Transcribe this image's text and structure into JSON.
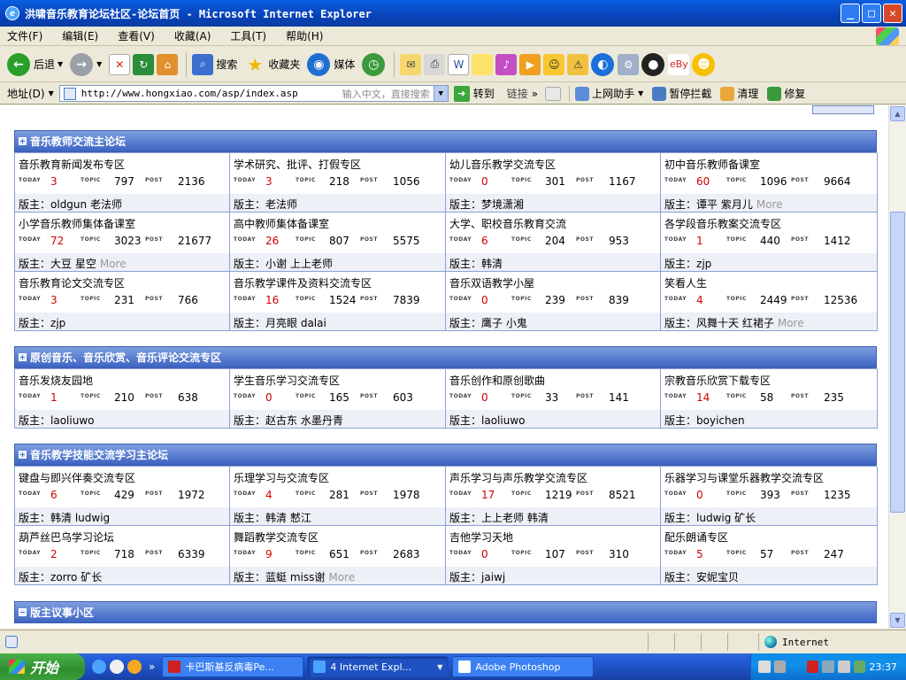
{
  "window": {
    "title": "洪啸音乐教育论坛社区-论坛首页 - Microsoft Internet Explorer"
  },
  "menu": [
    "文件(F)",
    "编辑(E)",
    "查看(V)",
    "收藏(A)",
    "工具(T)",
    "帮助(H)"
  ],
  "toolbar": {
    "back": "后退",
    "search": "搜索",
    "favorites": "收藏夹",
    "media": "媒体"
  },
  "address": {
    "label": "地址(D)",
    "url": "http://www.hongxiao.com/asp/index.asp",
    "hint": "输入中文，直接搜索",
    "go": "转到",
    "links": "链接",
    "helper": "上网助手",
    "popup": "暂停拦截",
    "clean": "清理",
    "fix": "修复"
  },
  "labels": {
    "today": "TODAY",
    "topic": "TOPIC",
    "post": "POST",
    "moderator": "版主：",
    "more": "More"
  },
  "sections": [
    {
      "title": "音乐教师交流主论坛",
      "toggle": "+",
      "forums": [
        {
          "name": "音乐教育新闻发布专区",
          "today": "3",
          "topic": "797",
          "post": "2136",
          "mods": "oldgun  老法师",
          "more": ""
        },
        {
          "name": "学术研究、批评、打假专区",
          "today": "3",
          "topic": "218",
          "post": "1056",
          "mods": "老法师",
          "more": ""
        },
        {
          "name": "幼儿音乐教学交流专区",
          "today": "0",
          "topic": "301",
          "post": "1167",
          "mods": "梦境潇湘",
          "more": ""
        },
        {
          "name": "初中音乐教师备课室",
          "today": "60",
          "topic": "1096",
          "post": "9664",
          "mods": "谭平  紫月儿",
          "more": "More"
        },
        {
          "name": "小学音乐教师集体备课室",
          "today": "72",
          "topic": "3023",
          "post": "21677",
          "mods": "大豆  星空",
          "more": "More"
        },
        {
          "name": "高中教师集体备课室",
          "today": "26",
          "topic": "807",
          "post": "5575",
          "mods": "小谢  上上老师",
          "more": ""
        },
        {
          "name": "大学、职校音乐教育交流",
          "today": "6",
          "topic": "204",
          "post": "953",
          "mods": "韩清",
          "more": ""
        },
        {
          "name": "各学段音乐教案交流专区",
          "today": "1",
          "topic": "440",
          "post": "1412",
          "mods": "zjp",
          "more": ""
        },
        {
          "name": "音乐教育论文交流专区",
          "today": "3",
          "topic": "231",
          "post": "766",
          "mods": "zjp",
          "more": ""
        },
        {
          "name": "音乐教学课件及资料交流专区",
          "today": "16",
          "topic": "1524",
          "post": "7839",
          "mods": "月亮眼  dalai",
          "more": ""
        },
        {
          "name": "音乐双语教学小屋",
          "today": "0",
          "topic": "239",
          "post": "839",
          "mods": "鹰子  小鬼",
          "more": ""
        },
        {
          "name": "笑看人生",
          "today": "4",
          "topic": "2449",
          "post": "12536",
          "mods": "风舞十天  红裙子",
          "more": "More"
        }
      ]
    },
    {
      "title": "原创音乐、音乐欣赏、音乐评论交流专区",
      "toggle": "+",
      "forums": [
        {
          "name": "音乐发烧友园地",
          "today": "1",
          "topic": "210",
          "post": "638",
          "mods": "laoliuwo",
          "more": ""
        },
        {
          "name": "学生音乐学习交流专区",
          "today": "0",
          "topic": "165",
          "post": "603",
          "mods": "赵古东  水墨丹青",
          "more": ""
        },
        {
          "name": "音乐创作和原创歌曲",
          "today": "0",
          "topic": "33",
          "post": "141",
          "mods": "laoliuwo",
          "more": ""
        },
        {
          "name": "宗教音乐欣赏下载专区",
          "today": "14",
          "topic": "58",
          "post": "235",
          "mods": "boyichen",
          "more": ""
        }
      ]
    },
    {
      "title": "音乐教学技能交流学习主论坛",
      "toggle": "+",
      "forums": [
        {
          "name": "键盘与即兴伴奏交流专区",
          "today": "6",
          "topic": "429",
          "post": "1972",
          "mods": "韩清  ludwig",
          "more": ""
        },
        {
          "name": "乐理学习与交流专区",
          "today": "4",
          "topic": "281",
          "post": "1978",
          "mods": "韩清  慭江",
          "more": ""
        },
        {
          "name": "声乐学习与声乐教学交流专区",
          "today": "17",
          "topic": "1219",
          "post": "8521",
          "mods": "上上老师  韩清",
          "more": ""
        },
        {
          "name": "乐器学习与课堂乐器教学交流专区",
          "today": "0",
          "topic": "393",
          "post": "1235",
          "mods": "ludwig  矿长",
          "more": ""
        },
        {
          "name": "葫芦丝巴乌学习论坛",
          "today": "2",
          "topic": "718",
          "post": "6339",
          "mods": "zorro  矿长",
          "more": ""
        },
        {
          "name": "舞蹈教学交流专区",
          "today": "9",
          "topic": "651",
          "post": "2683",
          "mods": "蓝蜓  miss谢",
          "more": "More"
        },
        {
          "name": "吉他学习天地",
          "today": "0",
          "topic": "107",
          "post": "310",
          "mods": "jaiwj",
          "more": ""
        },
        {
          "name": "配乐朗诵专区",
          "today": "5",
          "topic": "57",
          "post": "247",
          "mods": "安妮宝贝",
          "more": ""
        }
      ]
    },
    {
      "title": "版主议事小区",
      "toggle": "−",
      "forums": []
    }
  ],
  "status": {
    "zone": "Internet"
  },
  "taskbar": {
    "start": "开始",
    "tasks": [
      "卡巴斯基反病毒Pe...",
      "4 Internet Expl...",
      "Adobe Photoshop"
    ],
    "clock": "23:37"
  }
}
